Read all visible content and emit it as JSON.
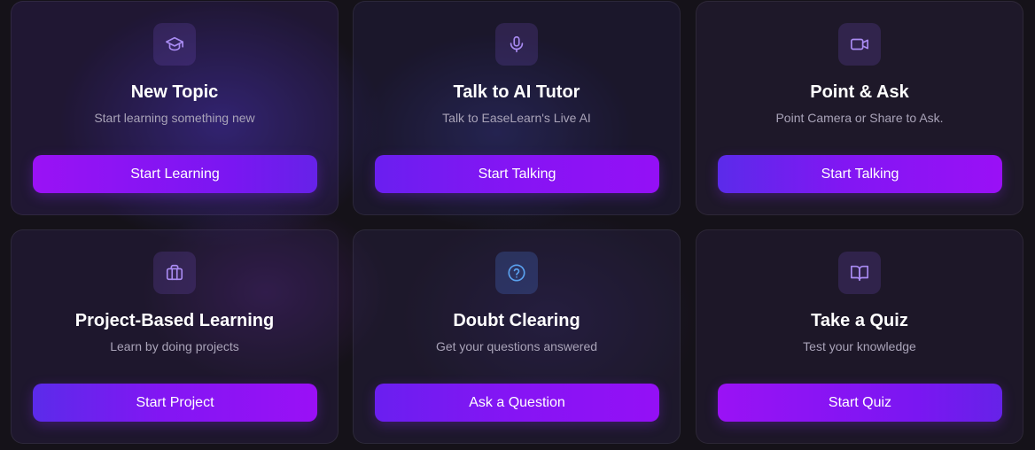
{
  "cards": [
    {
      "icon": "graduation-cap-icon",
      "title": "New Topic",
      "subtitle": "Start learning something new",
      "button_label": "Start Learning"
    },
    {
      "icon": "microphone-icon",
      "title": "Talk to AI Tutor",
      "subtitle": "Talk to EaseLearn's Live AI",
      "button_label": "Start Talking"
    },
    {
      "icon": "video-camera-icon",
      "title": "Point & Ask",
      "subtitle": "Point Camera or Share to Ask.",
      "button_label": "Start Talking"
    },
    {
      "icon": "briefcase-icon",
      "title": "Project-Based Learning",
      "subtitle": "Learn by doing projects",
      "button_label": "Start Project"
    },
    {
      "icon": "question-circle-icon",
      "title": "Doubt Clearing",
      "subtitle": "Get your questions answered",
      "button_label": "Ask a Question"
    },
    {
      "icon": "open-book-icon",
      "title": "Take a Quiz",
      "subtitle": "Test your knowledge",
      "button_label": "Start Quiz"
    }
  ],
  "colors": {
    "accent_purple": "#8c14f5",
    "accent_violet": "#6622e8",
    "icon_purple": "#a98bf2",
    "icon_blue": "#5aa2f0",
    "background": "#151219"
  }
}
